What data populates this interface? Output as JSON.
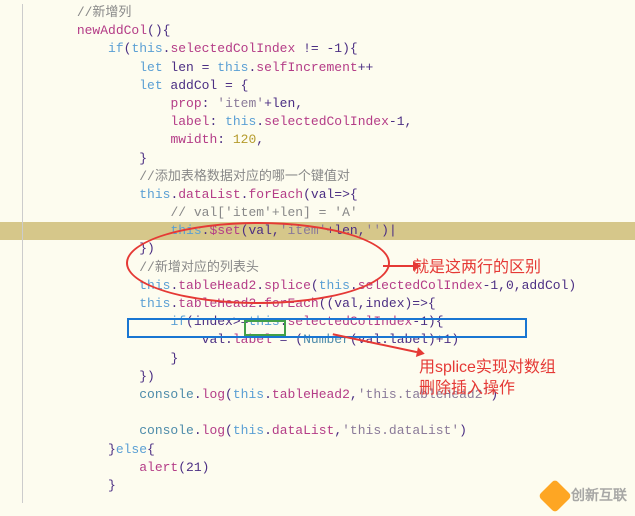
{
  "code": {
    "line1": "//新增列",
    "line2a": "newAddCol",
    "line2b": "(){",
    "line3a": "if",
    "line3b": "(",
    "line3c": "this",
    "line3d": ".",
    "line3e": "selectedColIndex",
    "line3f": " != -1){",
    "line4a": "let",
    "line4b": " len = ",
    "line4c": "this",
    "line4d": ".",
    "line4e": "selfIncrement",
    "line4f": "++",
    "line5a": "let",
    "line5b": " addCol = {",
    "line6a": "prop",
    "line6b": ": ",
    "line6c": "'item'",
    "line6d": "+len,",
    "line7a": "label",
    "line7b": ": ",
    "line7c": "this",
    "line7d": ".",
    "line7e": "selectedColIndex",
    "line7f": "-1,",
    "line8a": "mwidth",
    "line8b": ": ",
    "line8c": "120",
    "line8d": ",",
    "line9": "}",
    "line10": "//添加表格数据对应的哪一个键值对",
    "line11a": "this",
    "line11b": ".",
    "line11c": "dataList",
    "line11d": ".",
    "line11e": "forEach",
    "line11f": "(val=>{",
    "line12a": "// val['item'+len] = 'A'",
    "line13a": "this",
    "line13b": ".",
    "line13c": "$set",
    "line13d": "(val,",
    "line13e": "'item'",
    "line13f": "+len,",
    "line13g": "''",
    "line13h": ")|",
    "line14": "})",
    "line15": "//新增对应的列表头",
    "line16a": "this",
    "line16b": ".",
    "line16c": "tableHead2",
    "line16d": ".",
    "line16e": "splice",
    "line16f": "(",
    "line16g": "this",
    "line16h": ".",
    "line16i": "selectedColIndex",
    "line16j": "-1,0,addCol)",
    "line17a": "this",
    "line17b": ".",
    "line17c": "tableHead2",
    "line17d": ".",
    "line17e": "forEach",
    "line17f": "((val,index)=>{",
    "line18a": "if",
    "line18b": "(index>=",
    "line18c": "this",
    "line18d": ".",
    "line18e": "selectedColIndex",
    "line18f": "-1){",
    "line19a": "val.",
    "line19b": "label",
    "line19c": " = (",
    "line19d": "Number",
    "line19e": "(val.label)+1)",
    "line20": "}",
    "line21": "})",
    "line22a": "console",
    "line22b": ".",
    "line22c": "log",
    "line22d": "(",
    "line22e": "this",
    "line22f": ".",
    "line22g": "tableHead2",
    "line22h": ",",
    "line22i": "'this.tableHead2'",
    "line22j": ")",
    "line24a": "console",
    "line24b": ".",
    "line24c": "log",
    "line24d": "(",
    "line24e": "this",
    "line24f": ".",
    "line24g": "dataList",
    "line24h": ",",
    "line24i": "'this.dataList'",
    "line24j": ")",
    "line25a": "}",
    "line25b": "else",
    "line25c": "{",
    "line26a": "alert",
    "line26b": "(21)",
    "line27": "}"
  },
  "annotations": {
    "ann1": "就是这两行的区别",
    "ann2_line1": "用splice实现对数组",
    "ann2_line2": "删除插入操作"
  },
  "watermark": {
    "text": "创新互联"
  }
}
